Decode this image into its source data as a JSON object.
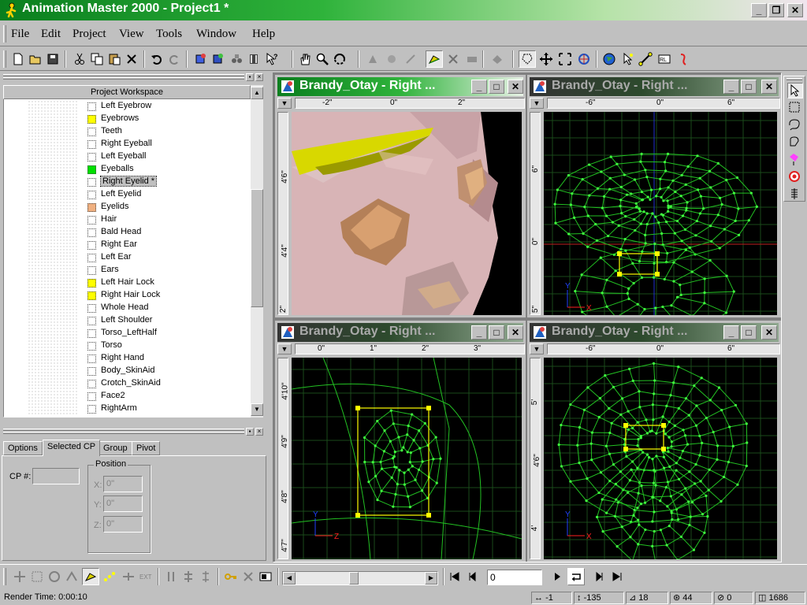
{
  "window": {
    "title": "Animation Master 2000 - Project1 *",
    "controls": {
      "minimize": "_",
      "restore": "❐",
      "close": "✕"
    },
    "accent_color": "#0a7e1e"
  },
  "menu": [
    "File",
    "Edit",
    "Project",
    "View",
    "Tools",
    "Window",
    "Help"
  ],
  "toolbar_icons": [
    "new-icon",
    "open-icon",
    "save-all-icon",
    "cut-icon",
    "copy-icon",
    "paste-icon",
    "delete-icon",
    "undo-icon",
    "redo-icon",
    "new-model-icon",
    "new-material-icon",
    "new-action-icon",
    "new-choreography-icon",
    "context-help-icon",
    "hand-icon",
    "zoom-icon",
    "turn-icon",
    "bone-mode-icon",
    "muscle-mode-icon",
    "skeletal-mode-icon",
    "modeling-mode-icon",
    "grab-icon",
    "scale-icon",
    "render-icon",
    "bounding-box-icon",
    "translate-icon",
    "scale-mode-icon",
    "rotate-icon",
    "globe-icon",
    "select-icon",
    "add-mode-icon",
    "render-lock-icon",
    "render-to-file-icon"
  ],
  "workspace": {
    "header": "Project Workspace",
    "items": [
      {
        "label": "Left Eyebrow",
        "color": ""
      },
      {
        "label": "Eyebrows",
        "color": "#ffff00"
      },
      {
        "label": "Teeth",
        "color": ""
      },
      {
        "label": "Right Eyeball",
        "color": ""
      },
      {
        "label": "Left Eyeball",
        "color": ""
      },
      {
        "label": "Eyeballs",
        "color": "#00e000"
      },
      {
        "label": "Right Eyelid *",
        "color": "",
        "selected": true
      },
      {
        "label": "Left Eyelid",
        "color": ""
      },
      {
        "label": "Eyelids",
        "color": "#f0b080"
      },
      {
        "label": "Hair",
        "color": ""
      },
      {
        "label": "Bald Head",
        "color": ""
      },
      {
        "label": "Right Ear",
        "color": ""
      },
      {
        "label": "Left Ear",
        "color": ""
      },
      {
        "label": "Ears",
        "color": ""
      },
      {
        "label": "Left Hair Lock",
        "color": "#ffff00"
      },
      {
        "label": "Right Hair Lock",
        "color": "#ffff00"
      },
      {
        "label": "Whole Head",
        "color": ""
      },
      {
        "label": "Left Shoulder",
        "color": ""
      },
      {
        "label": "Torso_LeftHalf",
        "color": ""
      },
      {
        "label": "Torso",
        "color": ""
      },
      {
        "label": "Right Hand",
        "color": ""
      },
      {
        "label": "Body_SkinAid",
        "color": ""
      },
      {
        "label": "Crotch_SkinAid",
        "color": ""
      },
      {
        "label": "Face2",
        "color": ""
      },
      {
        "label": "RightArm",
        "color": ""
      }
    ]
  },
  "properties": {
    "tabs": [
      "Options",
      "Selected CP",
      "Group",
      "Pivot"
    ],
    "active_tab": "Selected CP",
    "cp_label": "CP #:",
    "cp_value": "",
    "position_label": "Position",
    "x_label": "X:",
    "y_label": "Y:",
    "z_label": "Z:",
    "x_value": "0\"",
    "y_value": "0\"",
    "z_value": "0\""
  },
  "viewports": [
    {
      "title": "Brandy_Otay - Right ...",
      "active": true,
      "ruler_h": [
        "-2\"",
        "0\"",
        "2\""
      ],
      "ruler_v": [
        "4'6\"",
        "4'4\"",
        "2\""
      ]
    },
    {
      "title": "Brandy_Otay - Right ...",
      "active": false,
      "ruler_h": [
        "-6\"",
        "0\"",
        "6\""
      ],
      "ruler_v": [
        "6\"",
        "0\"",
        "5\""
      ]
    },
    {
      "title": "Brandy_Otay - Right ...",
      "active": false,
      "ruler_h": [
        "0\"",
        "1\"",
        "2\"",
        "3\""
      ],
      "ruler_v": [
        "4'10\"",
        "4'9\"",
        "4'8\"",
        "4'7\""
      ]
    },
    {
      "title": "Brandy_Otay - Right ...",
      "active": false,
      "ruler_h": [
        "-6\"",
        "0\"",
        "6\""
      ],
      "ruler_v": [
        "5'",
        "4'6\"",
        "4'"
      ]
    }
  ],
  "axis_labels": {
    "x": "X",
    "y": "Y",
    "z": "Z"
  },
  "frame_field": "0",
  "status": {
    "render_time": "Render Time:  0:00:10",
    "x": "-1",
    "y": "-135",
    "bones": "18",
    "cps": "44",
    "patches": "0",
    "polys": "1686"
  }
}
